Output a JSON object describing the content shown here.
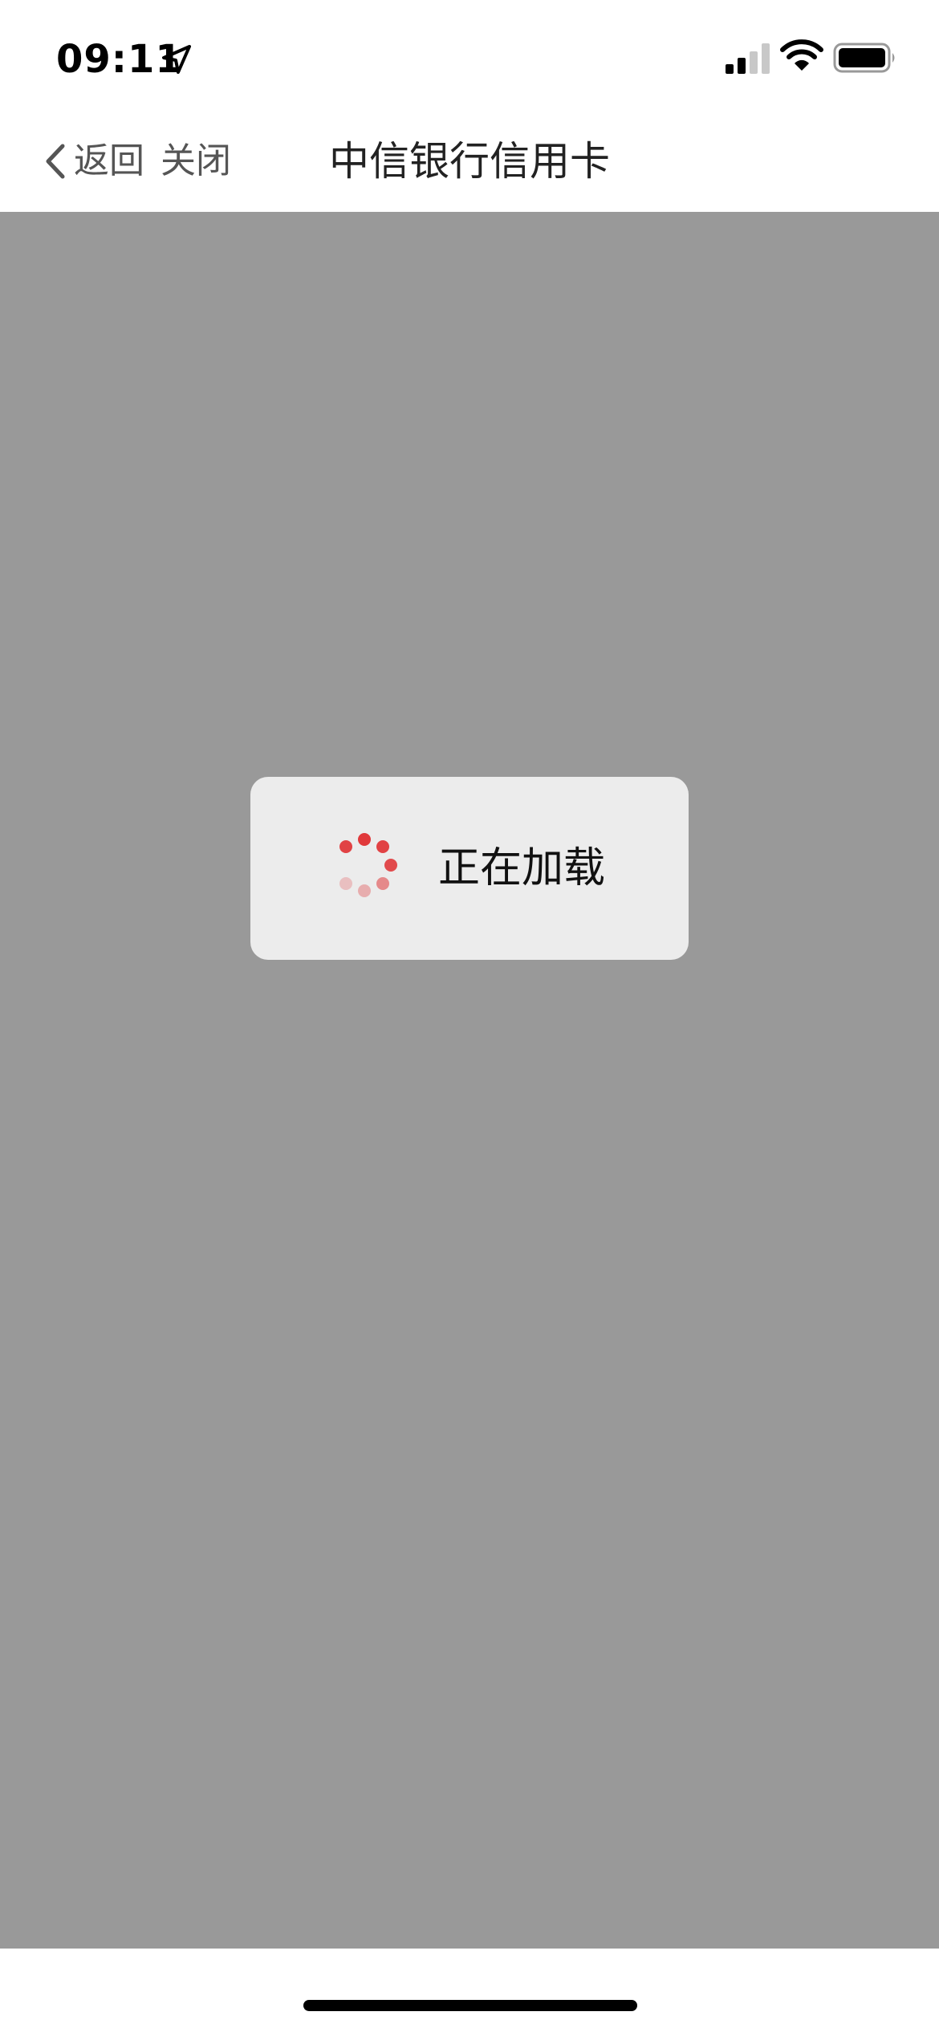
{
  "status_bar": {
    "time": "09:11",
    "icons": [
      "location-arrow-icon",
      "cellular-signal-icon",
      "wifi-icon",
      "battery-icon"
    ]
  },
  "nav_bar": {
    "back_label": "返回",
    "close_label": "关闭",
    "title": "中信银行信用卡"
  },
  "loading": {
    "text": "正在加载",
    "spinner_color": "#e0393b"
  },
  "colors": {
    "content_background": "#999999",
    "toast_background": "#ececec"
  }
}
